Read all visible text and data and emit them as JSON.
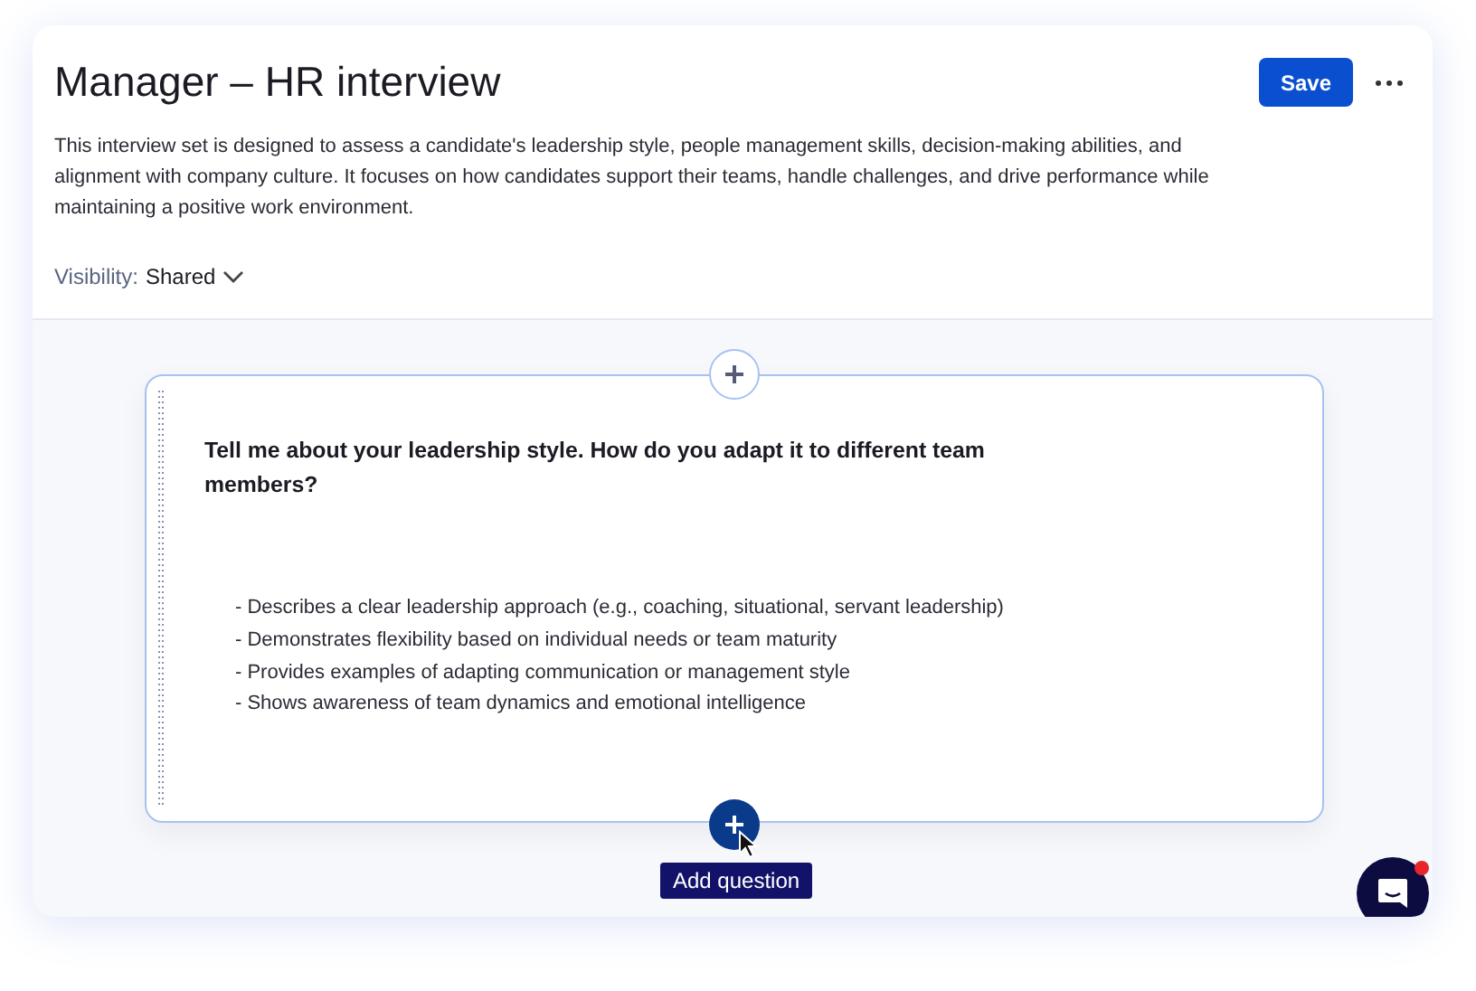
{
  "title": "Manager – HR interview",
  "save_button": "Save",
  "description": "This interview set is designed to assess a candidate's leadership style, people management skills, decision-making abilities, and alignment with company culture. It focuses on how candidates support their teams, handle challenges, and drive performance while maintaining a positive work environment.",
  "visibility": {
    "label": "Visibility:",
    "value": "Shared"
  },
  "question": {
    "text": "Tell me about your leadership style. How do you adapt it to different team members?",
    "criteria": [
      "- Describes a clear leadership approach (e.g., coaching, situational, servant leadership)",
      "- Demonstrates flexibility based on individual needs or team maturity",
      "- Provides examples of adapting communication or management style",
      "- Shows awareness of team dynamics and emotional intelligence"
    ]
  },
  "tooltip": "Add question",
  "chat": {
    "has_notification": true
  }
}
